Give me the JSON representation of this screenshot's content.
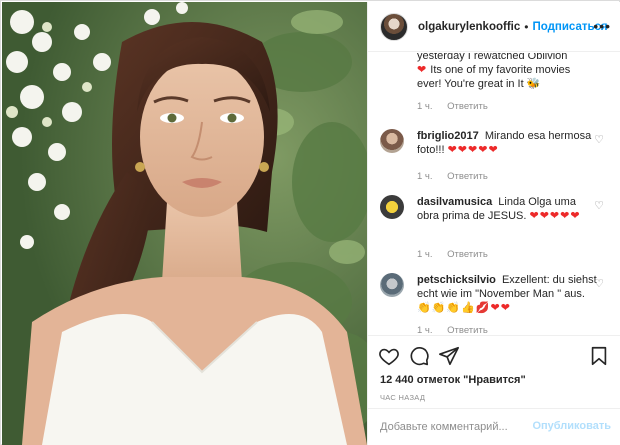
{
  "header": {
    "username": "olgakurylenkooffic",
    "separator": "•",
    "follow_label": "Подписаться",
    "more_label": "•••"
  },
  "comments": [
    {
      "username": "",
      "text": "yesterday I rewatched Oblivion",
      "text2": "Its one of my favorite movies ever! You're great in It",
      "emoji": "❤️ 🐝",
      "time": "1 ч.",
      "reply": "Ответить"
    },
    {
      "username": "fbriglio2017",
      "text": "Mirando esa hermosa foto!!!",
      "emoji": "❤❤❤❤❤",
      "time": "1 ч.",
      "reply": "Ответить"
    },
    {
      "username": "dasilvamusica",
      "text": "Linda Olga uma obra prima de JESUS.",
      "emoji": "❤❤❤❤❤",
      "time": "1 ч.",
      "reply": "Ответить"
    },
    {
      "username": "petschicksilvio",
      "text": "Exzellent: du siehst echt wie im \"November Man \" aus.",
      "emoji": "👏👏👏👍💋❤❤",
      "time": "1 ч.",
      "reply": "Ответить"
    }
  ],
  "actions": {
    "like_icon": "heart-outline-icon",
    "comment_icon": "comment-icon",
    "share_icon": "paper-plane-icon",
    "save_icon": "bookmark-icon"
  },
  "likes_text": "12 440 отметок \"Нравится\"",
  "date_text": "ЧАС НАЗАД",
  "add_comment": {
    "placeholder": "Добавьте комментарий...",
    "publish_label": "Опубликовать"
  },
  "colors": {
    "link_blue": "#0095f6",
    "publish_disabled": "#b2dffc",
    "heart_red": "#ed2a2a",
    "muted": "#8e8e8e"
  }
}
